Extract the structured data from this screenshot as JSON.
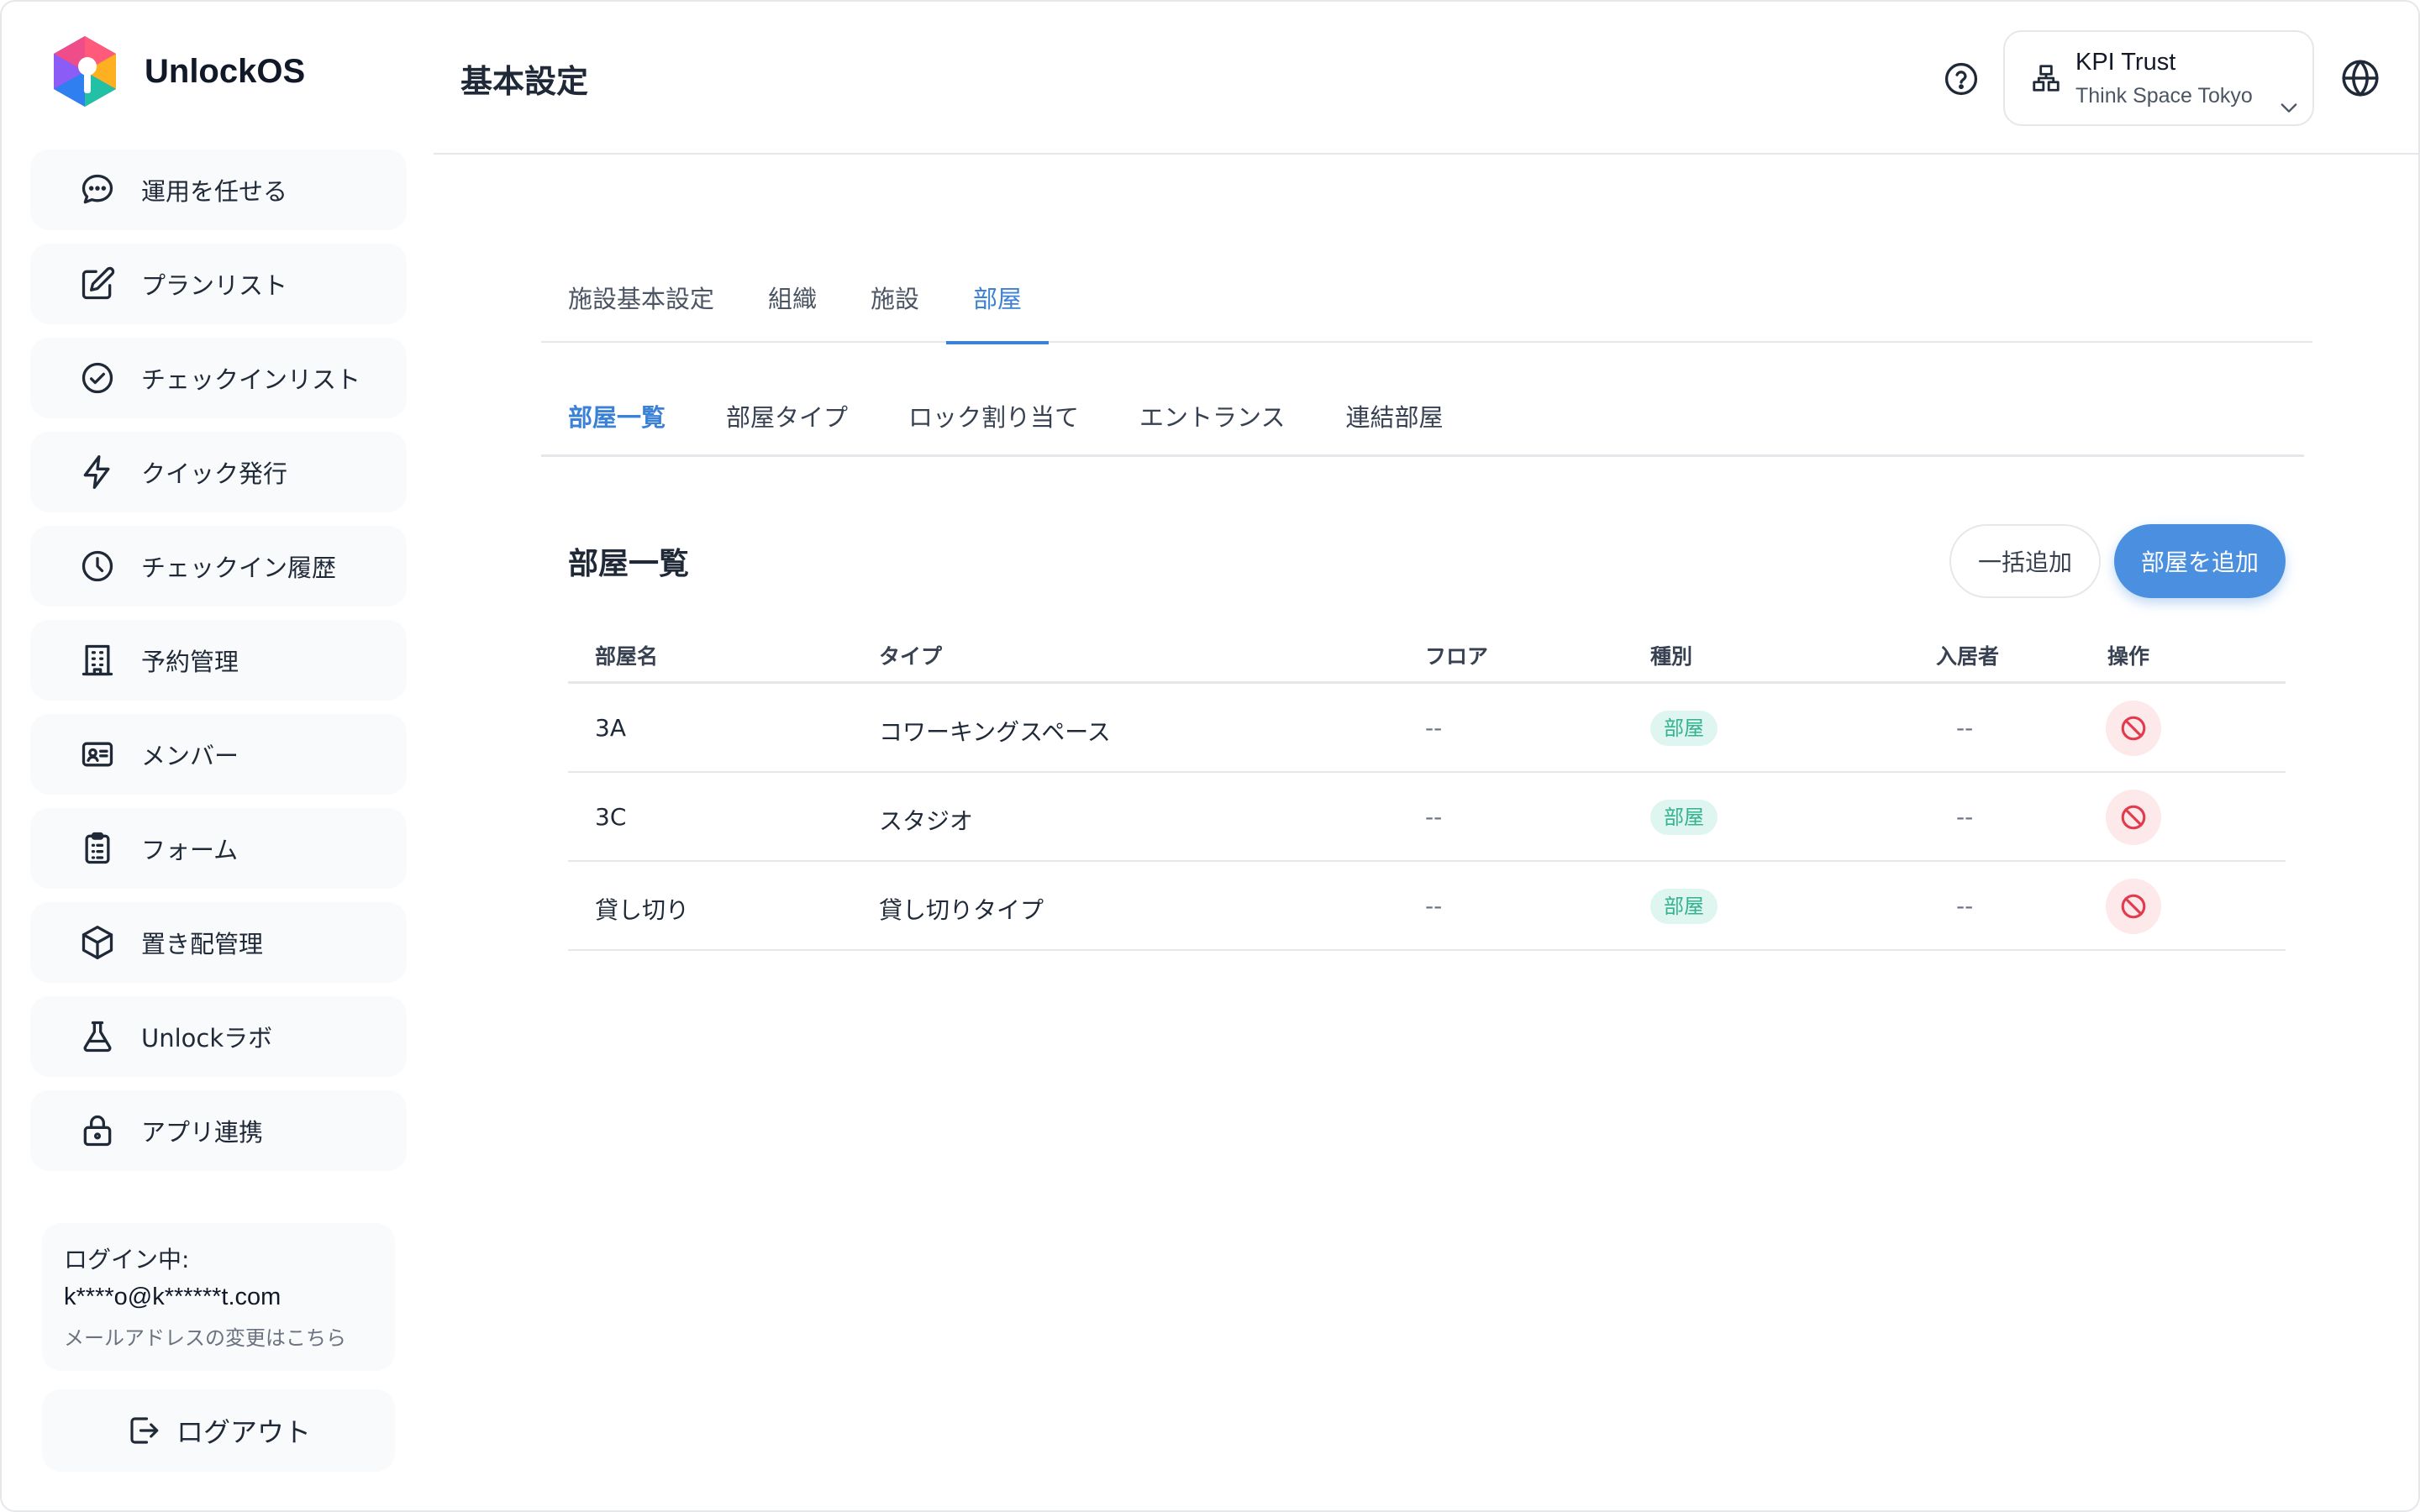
{
  "brand": {
    "name": "UnlockOS"
  },
  "sidebar": {
    "items": [
      {
        "label": "運用を任せる",
        "icon": "chat-bubble-icon"
      },
      {
        "label": "プランリスト",
        "icon": "edit-icon"
      },
      {
        "label": "チェックインリスト",
        "icon": "check-circle-icon"
      },
      {
        "label": "クイック発行",
        "icon": "lightning-icon"
      },
      {
        "label": "チェックイン履歴",
        "icon": "clock-icon"
      },
      {
        "label": "予約管理",
        "icon": "building-icon"
      },
      {
        "label": "メンバー",
        "icon": "id-card-icon"
      },
      {
        "label": "フォーム",
        "icon": "clipboard-icon"
      },
      {
        "label": "置き配管理",
        "icon": "package-icon"
      },
      {
        "label": "Unlockラボ",
        "icon": "flask-icon"
      },
      {
        "label": "アプリ連携",
        "icon": "lock-icon"
      }
    ],
    "login": {
      "title": "ログイン中:",
      "email": "k****o@k******t.com",
      "change_link": "メールアドレスの変更はこちら"
    },
    "logout_label": "ログアウト"
  },
  "header": {
    "title": "基本設定",
    "org_name": "KPI Trust",
    "org_sub": "Think Space Tokyo"
  },
  "tabs": [
    {
      "label": "施設基本設定",
      "active": false
    },
    {
      "label": "組織",
      "active": false
    },
    {
      "label": "施設",
      "active": false
    },
    {
      "label": "部屋",
      "active": true
    }
  ],
  "subtabs": [
    {
      "label": "部屋一覧",
      "active": true
    },
    {
      "label": "部屋タイプ",
      "active": false
    },
    {
      "label": "ロック割り当て",
      "active": false
    },
    {
      "label": "エントランス",
      "active": false
    },
    {
      "label": "連結部屋",
      "active": false
    }
  ],
  "section": {
    "title": "部屋一覧",
    "bulk_add_label": "一括追加",
    "add_label": "部屋を追加"
  },
  "table": {
    "columns": [
      "部屋名",
      "タイプ",
      "フロア",
      "種別",
      "入居者",
      "操作"
    ],
    "rows": [
      {
        "name": "3A",
        "type": "コワーキングスペース",
        "floor": "--",
        "kind": "部屋",
        "tenant": "--"
      },
      {
        "name": "3C",
        "type": "スタジオ",
        "floor": "--",
        "kind": "部屋",
        "tenant": "--"
      },
      {
        "name": "貸し切り",
        "type": "貸し切りタイプ",
        "floor": "--",
        "kind": "部屋",
        "tenant": "--"
      }
    ]
  },
  "colors": {
    "accent": "#3b82d6",
    "primary_button": "#4a8fe0",
    "badge_bg": "#dff5ef",
    "badge_text": "#34b38f",
    "danger_bg": "#fde8ea",
    "danger": "#e23b4e"
  }
}
